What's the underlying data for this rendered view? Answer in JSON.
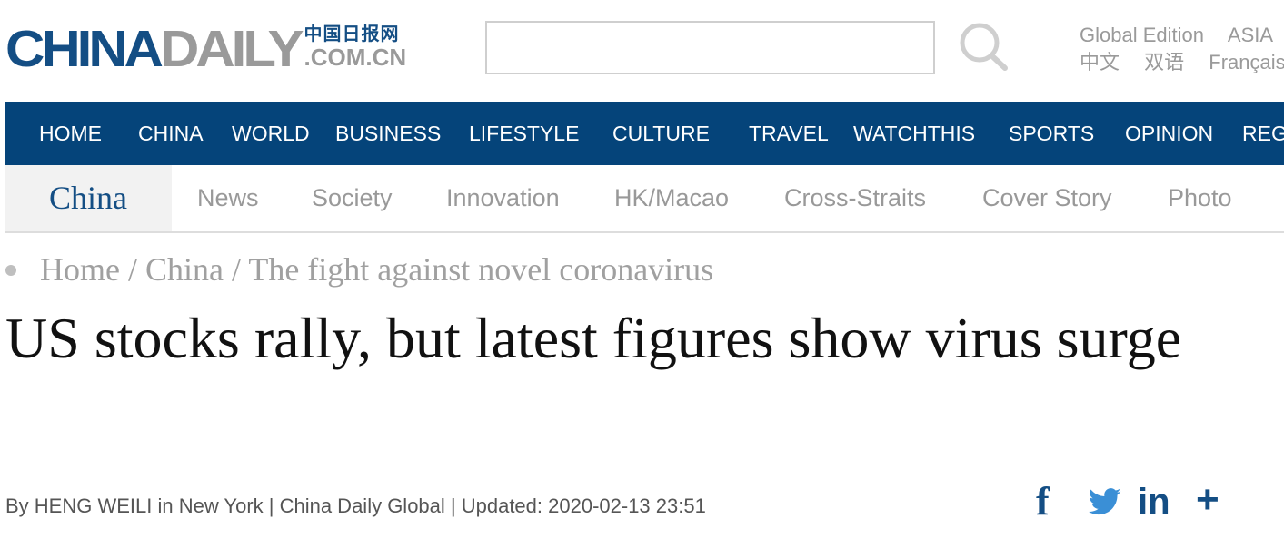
{
  "header": {
    "logo": {
      "primary": "CHINA",
      "secondary": "DAILY",
      "chinese": "中国日报网",
      "domain": ".COM.CN"
    },
    "search": {
      "placeholder": "",
      "icon": "search-icon"
    },
    "editions": {
      "row1": [
        "Global Edition",
        "ASIA"
      ],
      "row2": [
        "中文",
        "双语",
        "Français"
      ]
    }
  },
  "main_nav": {
    "items": [
      "HOME",
      "CHINA",
      "WORLD",
      "BUSINESS",
      "LIFESTYLE",
      "CULTURE",
      "TRAVEL",
      "WATCHTHIS",
      "SPORTS",
      "OPINION",
      "REG"
    ],
    "background": "#05447a"
  },
  "sub_nav": {
    "section": "China",
    "items": [
      "News",
      "Society",
      "Innovation",
      "HK/Macao",
      "Cross-Straits",
      "Cover Story",
      "Photo"
    ]
  },
  "breadcrumb": "Home / China / The fight against novel coronavirus",
  "article": {
    "headline": "US stocks rally, but latest figures show virus surge",
    "byline": "By HENG WEILI in New York | China Daily Global | Updated: 2020-02-13 23:51"
  },
  "share": {
    "icons": [
      "facebook-icon",
      "twitter-icon",
      "linkedin-icon",
      "plus-icon"
    ],
    "facebook": "f",
    "linkedin": "in",
    "more": "+"
  },
  "colors": {
    "brand": "#144e84",
    "muted": "#9a9a9a"
  }
}
